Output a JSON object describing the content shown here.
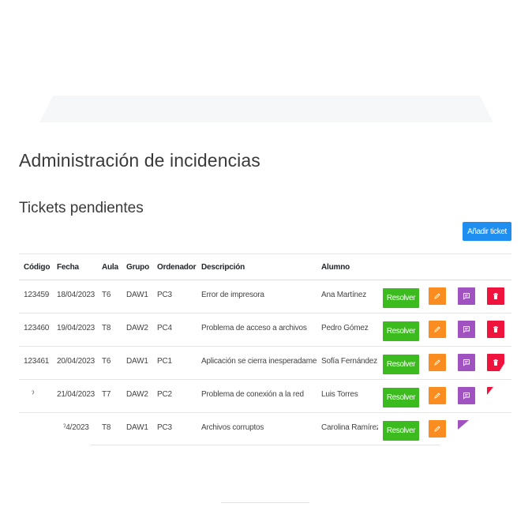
{
  "page": {
    "title": "Administración de incidencias",
    "section_title": "Tickets pendientes",
    "add_button": "Añadir ticket"
  },
  "table": {
    "headers": [
      "Código",
      "Fecha",
      "Aula",
      "Grupo",
      "Ordenador",
      "Descripción",
      "Alumno"
    ],
    "rows": [
      {
        "codigo": "123459",
        "fecha": "18/04/2023",
        "aula": "T6",
        "grupo": "DAW1",
        "ordenador": "PC3",
        "descripcion": "Error de impresora",
        "alumno": "Ana Martínez"
      },
      {
        "codigo": "123460",
        "fecha": "19/04/2023",
        "aula": "T8",
        "grupo": "DAW2",
        "ordenador": "PC4",
        "descripcion": "Problema de acceso a archivos",
        "alumno": "Pedro Gómez"
      },
      {
        "codigo": "123461",
        "fecha": "20/04/2023",
        "aula": "T6",
        "grupo": "DAW1",
        "ordenador": "PC1",
        "descripcion": "Aplicación se cierra inesperadamente",
        "alumno": "Sofía Fernández"
      },
      {
        "codigo": "ˀ",
        "fecha": "21/04/2023",
        "aula": "T7",
        "grupo": "DAW2",
        "ordenador": "PC2",
        "descripcion": "Problema de conexión a la red",
        "alumno": "Luis Torres"
      },
      {
        "codigo": "",
        "fecha": "ˀ4/2023",
        "aula": "T8",
        "grupo": "DAW1",
        "ordenador": "PC3",
        "descripcion": "Archivos corruptos",
        "alumno": "Carolina Ramírez"
      }
    ],
    "resolve_label": "Resolver"
  },
  "colors": {
    "primary": "#1f8ef1",
    "resolve": "#3cbb1f",
    "edit": "#fb8c1f",
    "comment": "#a052c0",
    "delete": "#f0133e"
  },
  "icons": {
    "edit": "pencil-icon",
    "comment": "comment-icon",
    "delete": "trash-icon"
  }
}
